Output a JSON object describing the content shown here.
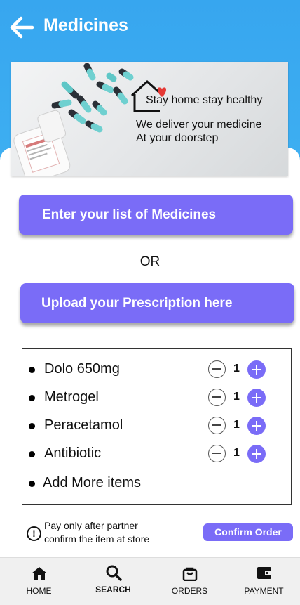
{
  "header": {
    "title": "Medicines"
  },
  "banner": {
    "tagline": "Stay home stay healthy",
    "line1": "We deliver your medicine",
    "line2": "At your doorstep"
  },
  "actions": {
    "enter_list": "Enter your list of Medicines",
    "or": "OR",
    "upload": "Upload your Prescription here"
  },
  "medicines": [
    {
      "name": "Dolo 650mg",
      "qty": "1"
    },
    {
      "name": "Metrogel",
      "qty": "1"
    },
    {
      "name": "Peracetamol",
      "qty": "1"
    },
    {
      "name": "Antibiotic",
      "qty": "1"
    }
  ],
  "add_more": "Add More items",
  "note": {
    "line1": "Pay only after partner",
    "line2": "confirm the item  at store"
  },
  "confirm_label": "Confirm Order",
  "nav": [
    {
      "label": "HOME",
      "icon": "home-icon"
    },
    {
      "label": "SEARCH",
      "icon": "search-icon",
      "active": true
    },
    {
      "label": "ORDERS",
      "icon": "shopping-bag-icon"
    },
    {
      "label": "PAYMENT",
      "icon": "wallet-icon"
    }
  ],
  "colors": {
    "accent": "#7a6cf7",
    "header_top": "#37a6ef",
    "header_bottom": "#4fc6f8",
    "heart": "#e53935"
  }
}
